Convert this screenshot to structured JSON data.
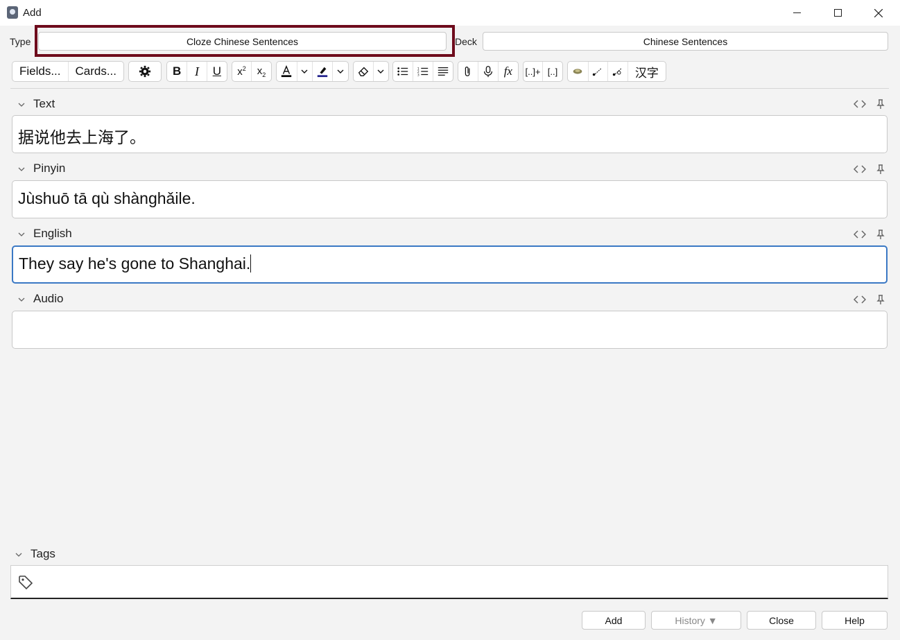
{
  "window": {
    "title": "Add"
  },
  "header": {
    "type_label": "Type",
    "type_value": "Cloze Chinese Sentences",
    "deck_label": "Deck",
    "deck_value": "Chinese Sentences"
  },
  "toolbar": {
    "fields_label": "Fields...",
    "cards_label": "Cards...",
    "chinese_label": "汉字",
    "icons": [
      "gear-icon",
      "bold-icon",
      "italic-icon",
      "underline-icon",
      "superscript-icon",
      "subscript-icon",
      "text-color-icon",
      "chevron-down-icon",
      "highlight-icon",
      "chevron-down-icon",
      "eraser-icon",
      "chevron-down-icon",
      "bullet-list-icon",
      "numbered-list-icon",
      "align-icon",
      "attachment-icon",
      "microphone-icon",
      "function-icon",
      "cloze-new-icon",
      "cloze-same-icon",
      "speaker-icon",
      "tone-icon",
      "tone-alt-icon"
    ],
    "text_color": "#000000",
    "highlight_color": "#1e1e8a"
  },
  "fields": [
    {
      "label": "Text",
      "value": "据说他去上海了。"
    },
    {
      "label": "Pinyin",
      "value": "Jùshuō tā qù shànghǎile."
    },
    {
      "label": "English",
      "value": "They say he's gone to Shanghai."
    },
    {
      "label": "Audio",
      "value": ""
    }
  ],
  "tags": {
    "label": "Tags"
  },
  "buttons": {
    "add": "Add",
    "history": "History ▼",
    "close": "Close",
    "help": "Help"
  },
  "colors": {
    "highlight_border": "#6e0b1c",
    "focus_border": "#3a78c4"
  }
}
